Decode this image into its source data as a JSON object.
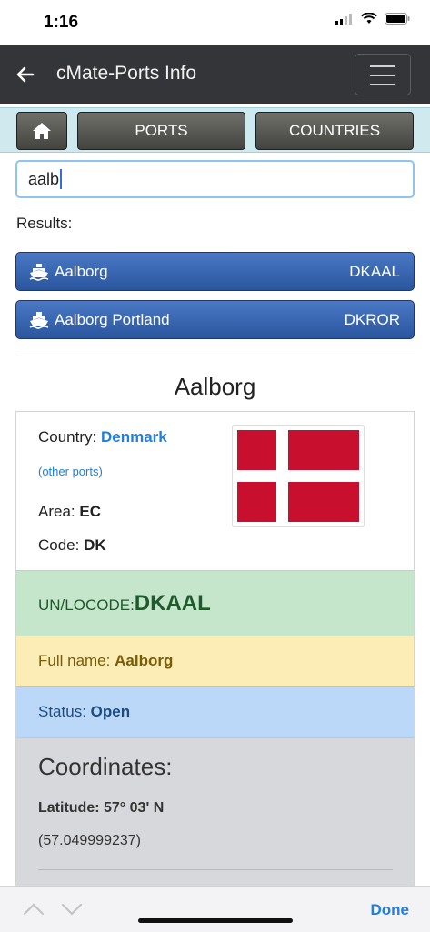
{
  "status_bar": {
    "time": "1:16"
  },
  "nav": {
    "back_icon": "arrow-left-icon",
    "title": "cMate-Ports Info",
    "menu_icon": "hamburger-icon"
  },
  "toolbar": {
    "home_icon": "home-icon",
    "ports_label": "PORTS",
    "countries_label": "COUNTRIES"
  },
  "search": {
    "value": "aalb"
  },
  "results": {
    "label": "Results:",
    "items": [
      {
        "icon": "ship-icon",
        "name": "Aalborg",
        "code": "DKAAL"
      },
      {
        "icon": "ship-icon",
        "name": "Aalborg Portland",
        "code": "DKROR"
      }
    ]
  },
  "port": {
    "title": "Aalborg",
    "country_label": "Country:",
    "country_value": "Denmark",
    "other_ports": "(other ports)",
    "area_label": "Area:",
    "area_value": "EC",
    "code_label": "Code:",
    "code_value": "DK",
    "flag_icon": "denmark-flag",
    "unlocode_label": "UN/LOCODE:",
    "unlocode_value": "DKAAL",
    "fullname_label": "Full name:",
    "fullname_value": "Aalborg",
    "status_label": "Status:",
    "status_value": "Open",
    "coordinates_title": "Coordinates:",
    "latitude_label": "Latitude:",
    "latitude_value": "57° 03' N",
    "latitude_decimal": "(57.049999237)"
  },
  "keyboard_bar": {
    "up_icon": "chevron-up-icon",
    "down_icon": "chevron-down-icon",
    "done_label": "Done"
  },
  "colors": {
    "nav_bg": "#333538",
    "result_blue": "#2a569e",
    "link_blue": "#1f7fe0",
    "flag_red": "#c8102e"
  }
}
